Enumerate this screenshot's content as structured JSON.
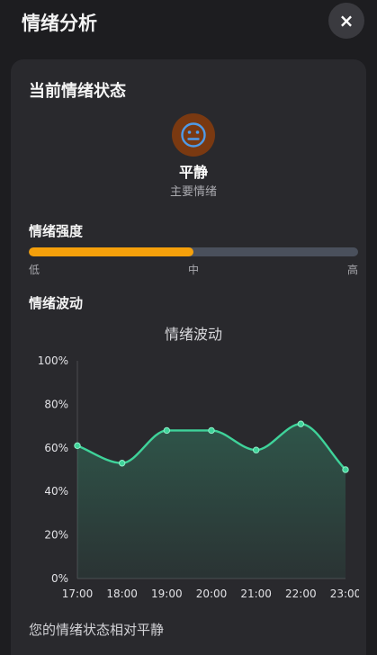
{
  "header": {
    "title": "情绪分析",
    "close_label": "×",
    "close_icon": "close-icon"
  },
  "current": {
    "section_title": "当前情绪状态",
    "emotion_icon": "neutral-face-icon",
    "emotion": "平静",
    "emotion_caption": "主要情绪"
  },
  "intensity": {
    "section_title": "情绪强度",
    "value": 0.5,
    "labels": {
      "low": "低",
      "mid": "中",
      "high": "高"
    }
  },
  "fluctuation": {
    "section_title": "情绪波动"
  },
  "chart_data": {
    "type": "line",
    "title": "情绪波动",
    "categories": [
      "17:00",
      "18:00",
      "19:00",
      "20:00",
      "21:00",
      "22:00",
      "23:00"
    ],
    "series": [
      {
        "values": [
          61,
          53,
          68,
          68,
          59,
          71,
          50
        ]
      }
    ],
    "ylim": [
      0,
      100
    ],
    "yticks": [
      0,
      20,
      40,
      60,
      80,
      100
    ],
    "ytick_labels": [
      "0%",
      "20%",
      "40%",
      "60%",
      "80%",
      "100%"
    ],
    "xlabel": "",
    "ylabel": "",
    "smooth": true,
    "area_fill": true,
    "grid": false,
    "legend": "none"
  },
  "summary": "您的情绪状态相对平静",
  "colors": {
    "background": "#1d1d20",
    "card": "#29292d",
    "accent_orange": "#f5a00b",
    "bar_track": "#4a505c",
    "emotion_badge": "#7a3911",
    "emotion_icon": "#4f9be8",
    "line": "#3fd39a"
  }
}
